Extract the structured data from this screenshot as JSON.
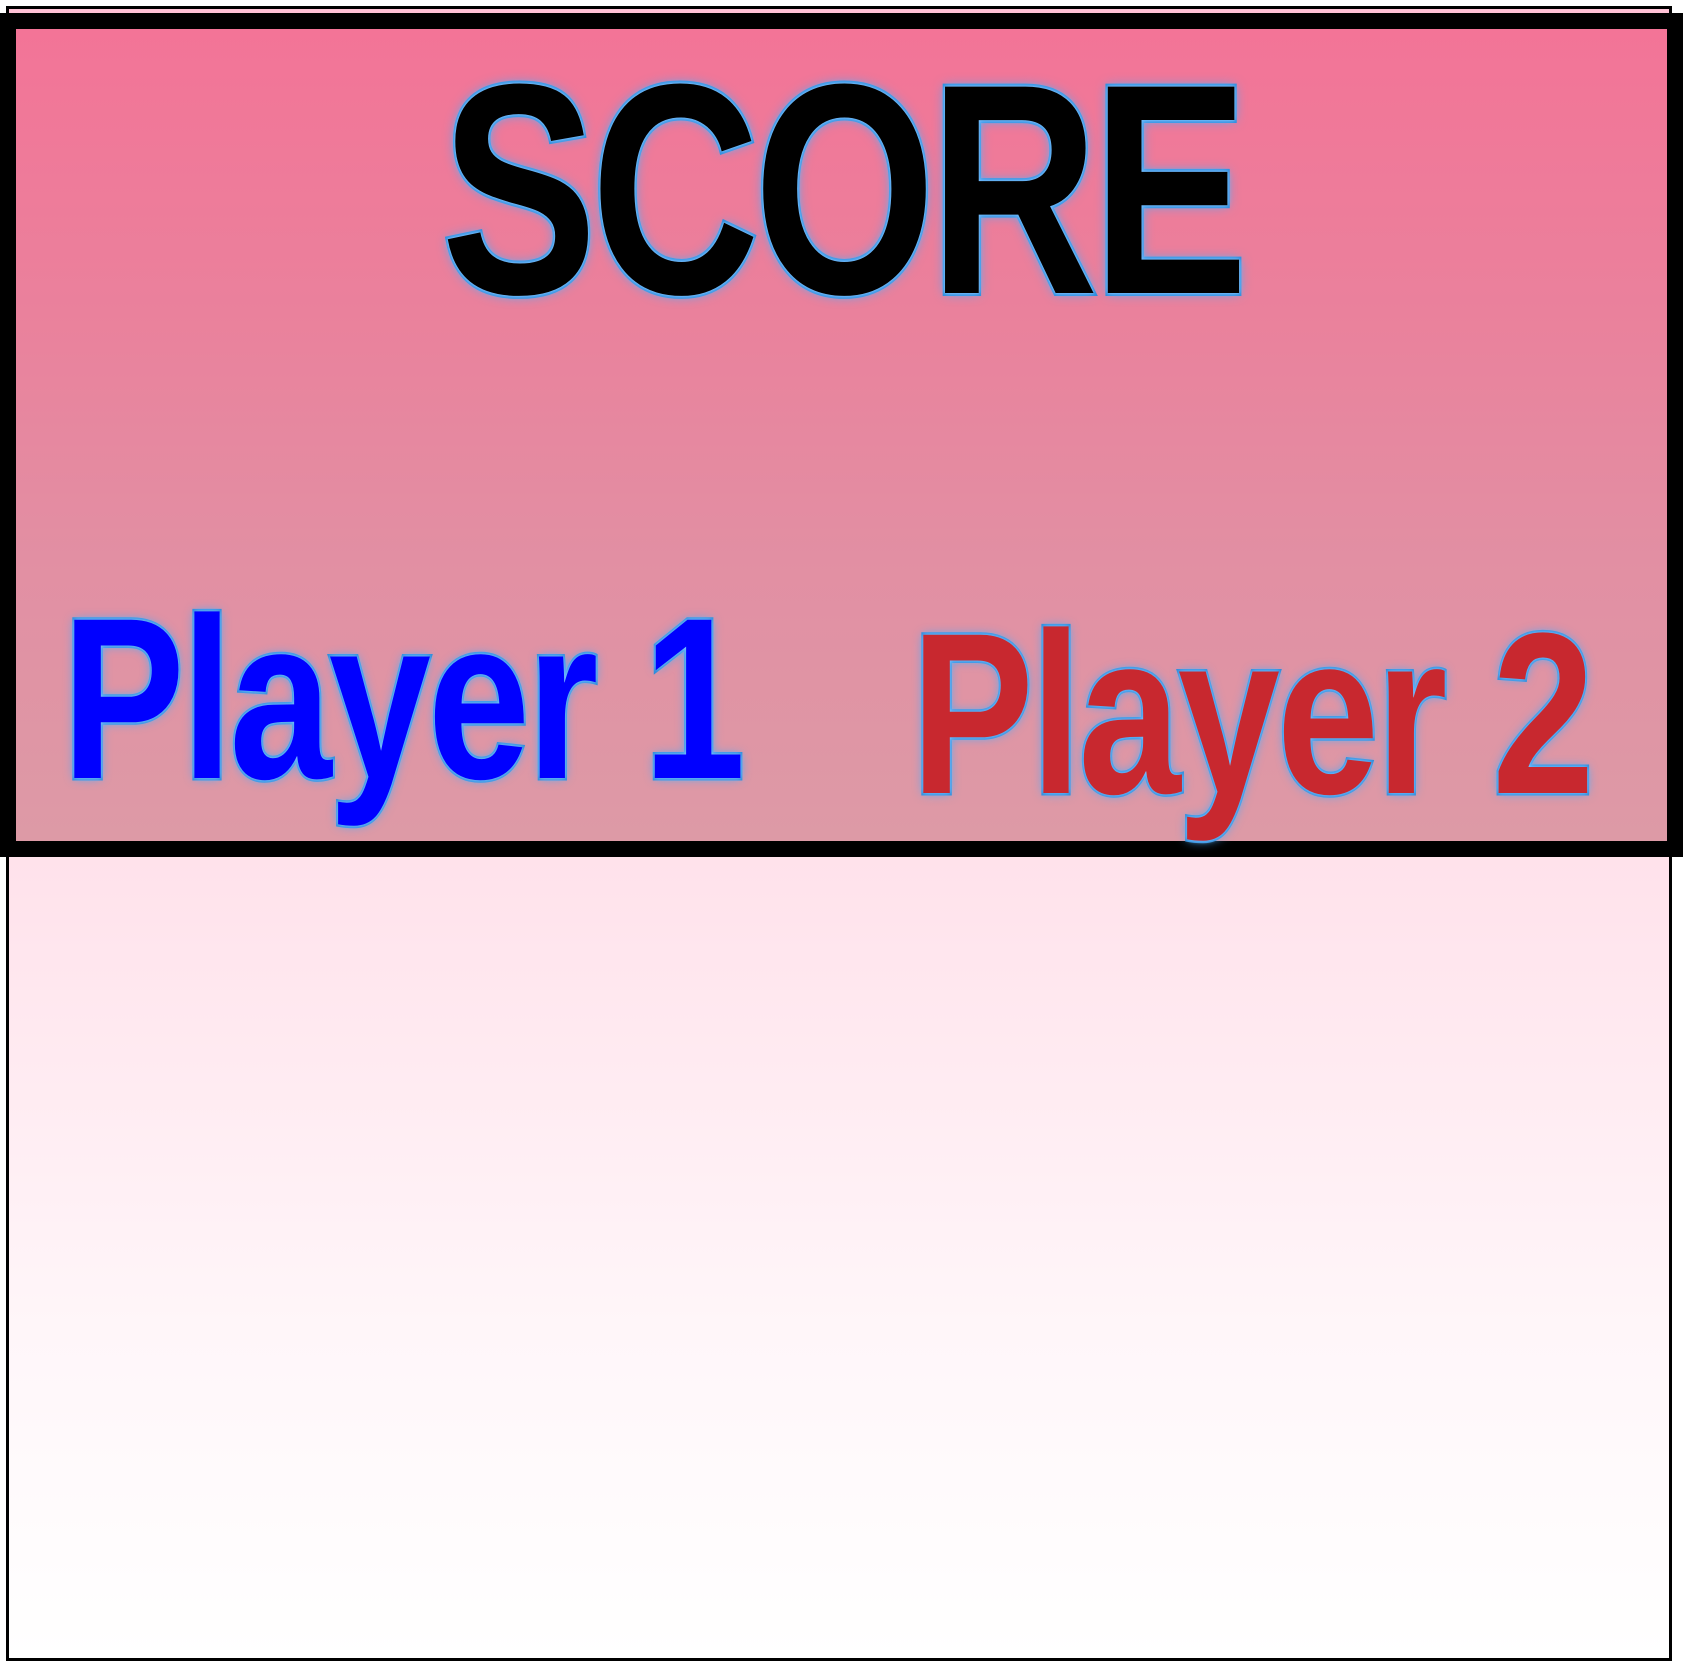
{
  "header": {
    "title": "SCORE",
    "player1_label": "Player 1",
    "player2_label": "Player 2"
  },
  "colors": {
    "header_top": "#f37497",
    "header_bottom": "#dd9aa6",
    "body_top": "#ffc2d6",
    "body_bottom": "#ffffff",
    "title_fill": "#000000",
    "outline_glow": "#2d8ad9",
    "player1_color": "#0000ff",
    "player2_color": "#c8282f",
    "border": "#000000"
  }
}
